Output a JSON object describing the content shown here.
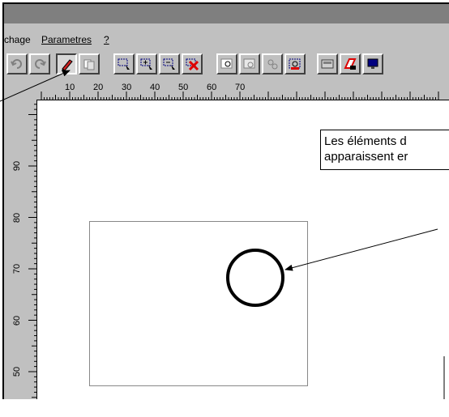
{
  "menu": {
    "items": [
      "chage",
      "Parametres",
      "?"
    ]
  },
  "toolbar": {
    "buttons": [
      "undo",
      "redo",
      "pencil",
      "copy",
      "select",
      "select-add",
      "select-remove",
      "delete",
      "zoom",
      "zoom-window",
      "zoom-out",
      "zoom-fit",
      "view",
      "erase",
      "monitor"
    ]
  },
  "ruler": {
    "horizontal": [
      "10",
      "20",
      "30",
      "40",
      "50",
      "60",
      "70"
    ],
    "vertical": [
      "90",
      "80",
      "70",
      "60",
      "50"
    ]
  },
  "callout": {
    "line1": "Les éléments d",
    "line2": "apparaissent er"
  },
  "colors": {
    "window_bg": "#c0c0c0",
    "titlebar": "#7f7f7f",
    "canvas": "#ffffff"
  }
}
